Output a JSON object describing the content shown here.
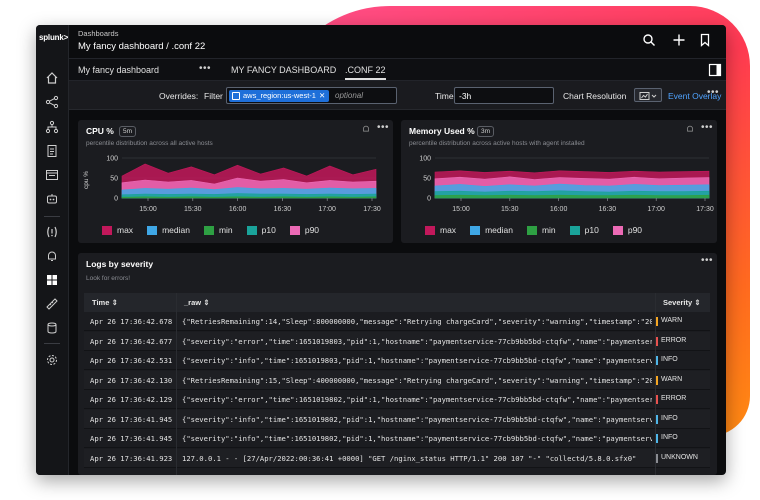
{
  "app": {
    "logo": "splunk>",
    "breadcrumb_top": "Dashboards",
    "breadcrumb_main": "My fancy dashboard  /  .conf 22"
  },
  "tabs": [
    {
      "label": "My fancy dashboard"
    },
    {
      "label": "MY FANCY DASHBOARD"
    },
    {
      "label": ".CONF 22"
    }
  ],
  "overrides": {
    "label": "Overrides:",
    "filter_label": "Filter",
    "filter_chip": "aws_region:us-west-1",
    "filter_placeholder": "optional",
    "time_label": "Time",
    "time_value": "-3h",
    "resolution_label": "Chart Resolution",
    "event_overlay": "Event Overlay"
  },
  "cpu_panel": {
    "title": "CPU %",
    "badge": "5m",
    "subtitle": "percentile distribution across all active hosts"
  },
  "mem_panel": {
    "title": "Memory Used %",
    "badge": "3m",
    "subtitle": "percentile distribution across active hosts with agent installed"
  },
  "colors": {
    "max": "#c2185b",
    "median": "#3fa7e6",
    "min": "#2ea043",
    "p10": "#1aa39a",
    "p90": "#ec6ab5",
    "warn": "#f5a623",
    "error": "#e8524f",
    "info": "#4fb6e8",
    "unknown": "#8a8c92"
  },
  "chart_data": [
    {
      "type": "area",
      "title": "CPU %",
      "ylabel": "cpu %",
      "x": [
        "15:00",
        "15:30",
        "16:00",
        "16:30",
        "17:00",
        "17:30"
      ],
      "y_ticks": [
        0,
        50,
        100
      ],
      "ylim": [
        0,
        100
      ],
      "series": [
        {
          "name": "max",
          "values": [
            55,
            85,
            62,
            78,
            58,
            82,
            60,
            75,
            55,
            80,
            58,
            72
          ]
        },
        {
          "name": "p90",
          "values": [
            38,
            45,
            40,
            44,
            35,
            50,
            42,
            46,
            38,
            44,
            40,
            42
          ]
        },
        {
          "name": "median",
          "values": [
            20,
            24,
            22,
            25,
            21,
            26,
            23,
            24,
            22,
            25,
            23,
            24
          ]
        },
        {
          "name": "p10",
          "values": [
            8,
            10,
            9,
            10,
            9,
            11,
            10,
            10,
            9,
            10,
            9,
            10
          ]
        },
        {
          "name": "min",
          "values": [
            2,
            3,
            2,
            3,
            2,
            3,
            2,
            3,
            2,
            3,
            2,
            3
          ]
        }
      ],
      "legend": [
        "max",
        "median",
        "min",
        "p10",
        "p90"
      ],
      "grid": true
    },
    {
      "type": "area",
      "title": "Memory Used %",
      "x": [
        "15:00",
        "15:30",
        "16:00",
        "16:30",
        "17:00",
        "17:30"
      ],
      "y_ticks": [
        0,
        50,
        100
      ],
      "ylim": [
        0,
        100
      ],
      "series": [
        {
          "name": "max",
          "values": [
            65,
            68,
            64,
            67,
            63,
            68,
            66,
            64,
            67,
            65,
            66,
            67
          ]
        },
        {
          "name": "p90",
          "values": [
            48,
            52,
            47,
            53,
            46,
            51,
            49,
            47,
            52,
            48,
            50,
            51
          ]
        },
        {
          "name": "median",
          "values": [
            30,
            34,
            29,
            33,
            30,
            35,
            31,
            30,
            34,
            31,
            32,
            33
          ]
        },
        {
          "name": "p10",
          "values": [
            16,
            17,
            15,
            17,
            16,
            18,
            16,
            15,
            17,
            16,
            16,
            17
          ]
        },
        {
          "name": "min",
          "values": [
            6,
            7,
            6,
            7,
            6,
            7,
            6,
            6,
            7,
            6,
            6,
            7
          ]
        }
      ],
      "legend": [
        "max",
        "median",
        "min",
        "p10",
        "p90"
      ],
      "grid": true
    }
  ],
  "logs_panel": {
    "title": "Logs by severity",
    "subtitle": "Look for errors!",
    "columns": [
      "Time",
      "_raw",
      "Severity"
    ],
    "rows": [
      {
        "time": "Apr 26 17:36:42.678",
        "raw": "{\"RetriesRemaining\":14,\"Sleep\":800000000,\"message\":\"Retrying chargeCard\",\"severity\":\"warning\",\"timestamp\":\"2022",
        "severity": "WARN",
        "level": "warn"
      },
      {
        "time": "Apr 26 17:36:42.677",
        "raw": "{\"severity\":\"error\",\"time\":1651019803,\"pid\":1,\"hostname\":\"paymentservice-77cb9bb5bd-ctqfw\",\"name\":\"paymentservi",
        "severity": "ERROR",
        "level": "error"
      },
      {
        "time": "Apr 26 17:36:42.531",
        "raw": "{\"severity\":\"info\",\"time\":1651019803,\"pid\":1,\"hostname\":\"paymentservice-77cb9bb5bd-ctqfw\",\"name\":\"paymentservic",
        "severity": "INFO",
        "level": "info"
      },
      {
        "time": "Apr 26 17:36:42.130",
        "raw": "{\"RetriesRemaining\":15,\"Sleep\":400000000,\"message\":\"Retrying chargeCard\",\"severity\":\"warning\",\"timestamp\":\"2022",
        "severity": "WARN",
        "level": "warn"
      },
      {
        "time": "Apr 26 17:36:42.129",
        "raw": "{\"severity\":\"error\",\"time\":1651019802,\"pid\":1,\"hostname\":\"paymentservice-77cb9bb5bd-ctqfw\",\"name\":\"paymentservi",
        "severity": "ERROR",
        "level": "error"
      },
      {
        "time": "Apr 26 17:36:41.945",
        "raw": "{\"severity\":\"info\",\"time\":1651019802,\"pid\":1,\"hostname\":\"paymentservice-77cb9bb5bd-ctqfw\",\"name\":\"paymentservic",
        "severity": "INFO",
        "level": "info"
      },
      {
        "time": "Apr 26 17:36:41.945",
        "raw": "{\"severity\":\"info\",\"time\":1651019802,\"pid\":1,\"hostname\":\"paymentservice-77cb9bb5bd-ctqfw\",\"name\":\"paymentservic",
        "severity": "INFO",
        "level": "info"
      },
      {
        "time": "Apr 26 17:36:41.923",
        "raw": "127.0.0.1 - - [27/Apr/2022:00:36:41 +0000] \"GET /nginx_status HTTP/1.1\" 200 107 \"-\" \"collectd/5.8.0.sfx0\"",
        "severity": "UNKNOWN",
        "level": "unknown"
      }
    ]
  }
}
